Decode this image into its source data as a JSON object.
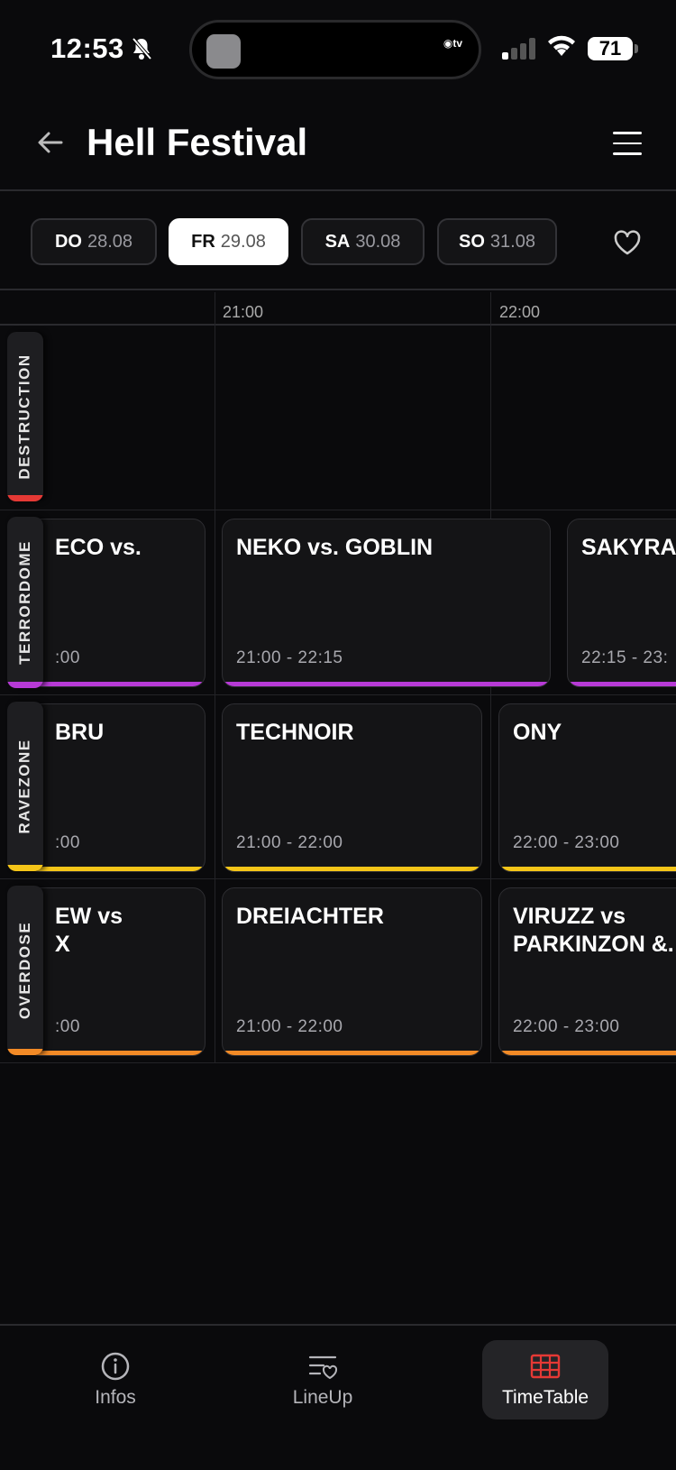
{
  "status": {
    "time": "12:53",
    "battery": "71"
  },
  "header": {
    "title": "Hell Festival"
  },
  "days": [
    {
      "wd": "DO",
      "date": "28.08",
      "active": false
    },
    {
      "wd": "FR",
      "date": "29.08",
      "active": true
    },
    {
      "wd": "SA",
      "date": "30.08",
      "active": false
    },
    {
      "wd": "SO",
      "date": "31.08",
      "active": false
    }
  ],
  "timeline": {
    "ticks": [
      "21:00",
      "22:00"
    ]
  },
  "stages": [
    {
      "name": "DESTRUCTION",
      "color": "#e53935",
      "sets": []
    },
    {
      "name": "TERRORDOME",
      "color": "#b73ad6",
      "sets": [
        {
          "act": "ECO vs.",
          "time": ":00"
        },
        {
          "act": "NEKO vs. GOBLIN",
          "time": "21:00 - 22:15"
        },
        {
          "act": "SAKYRA",
          "time": "22:15 - 23:"
        }
      ]
    },
    {
      "name": "RAVEZONE",
      "color": "#f5c518",
      "sets": [
        {
          "act": "BRU",
          "time": ":00"
        },
        {
          "act": "TECHNOIR",
          "time": "21:00 - 22:00"
        },
        {
          "act": "ONY",
          "time": "22:00 - 23:00"
        }
      ]
    },
    {
      "name": "OVERDOSE",
      "color": "#f28a26",
      "sets": [
        {
          "act": "EW vs\nX",
          "time": ":00"
        },
        {
          "act": "DREIACHTER",
          "time": "21:00 - 22:00"
        },
        {
          "act": "VIRUZZ vs\nPARKINZON &.",
          "time": "22:00 - 23:00"
        }
      ]
    }
  ],
  "nav": {
    "infos": "Infos",
    "lineup": "LineUp",
    "timetable": "TimeTable",
    "accent": "#e53935"
  }
}
